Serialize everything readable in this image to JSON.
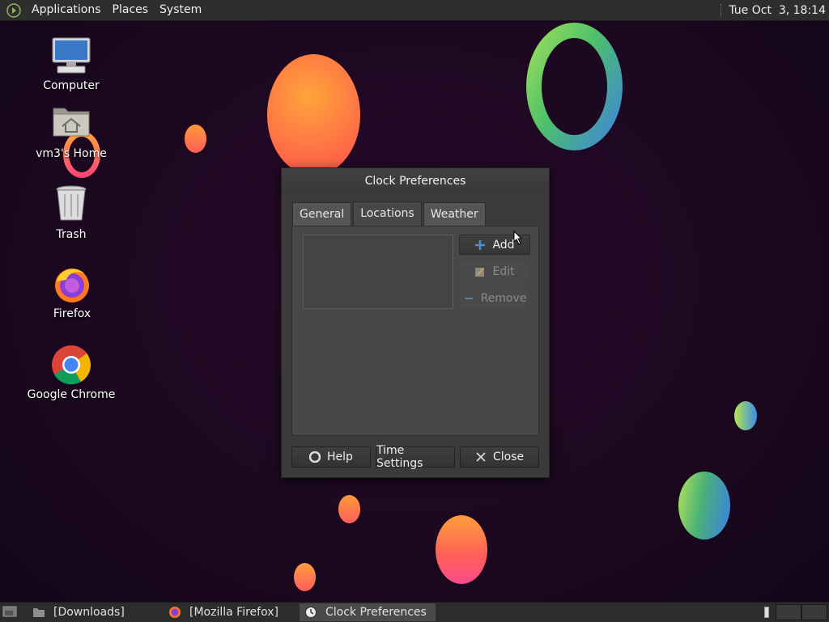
{
  "top_panel": {
    "menus": [
      "Applications",
      "Places",
      "System"
    ],
    "clock": "Tue Oct  3, 18:14"
  },
  "desktop_icons": [
    {
      "label": "Computer",
      "icon": "computer-icon"
    },
    {
      "label": "vm3's Home",
      "icon": "home-folder-icon"
    },
    {
      "label": "Trash",
      "icon": "trash-icon"
    },
    {
      "label": "Firefox",
      "icon": "firefox-icon"
    },
    {
      "label": "Google Chrome",
      "icon": "chrome-icon"
    }
  ],
  "dialog": {
    "title": "Clock Preferences",
    "tabs": [
      "General",
      "Locations",
      "Weather"
    ],
    "active_tab": "Locations",
    "side_buttons": [
      {
        "label": "Add",
        "icon": "plus-icon",
        "enabled": true
      },
      {
        "label": "Edit",
        "icon": "edit-icon",
        "enabled": false
      },
      {
        "label": "Remove",
        "icon": "minus-icon",
        "enabled": false
      }
    ],
    "footer_buttons": [
      {
        "label": "Help",
        "icon": "help-icon"
      },
      {
        "label": "Time Settings",
        "icon": ""
      },
      {
        "label": "Close",
        "icon": "close-icon"
      }
    ]
  },
  "taskbar": {
    "tasks": [
      {
        "label": "[Downloads]",
        "icon": "folder-icon",
        "active": false
      },
      {
        "label": "[Mozilla Firefox]",
        "icon": "firefox-icon",
        "active": false
      },
      {
        "label": "Clock Preferences",
        "icon": "clock-icon",
        "active": true
      }
    ]
  },
  "colors": {
    "background": "#1c0820",
    "panel": "#2e2e2e",
    "dialog": "#3b3b3b",
    "accent_blue": "#4a8fd8"
  }
}
